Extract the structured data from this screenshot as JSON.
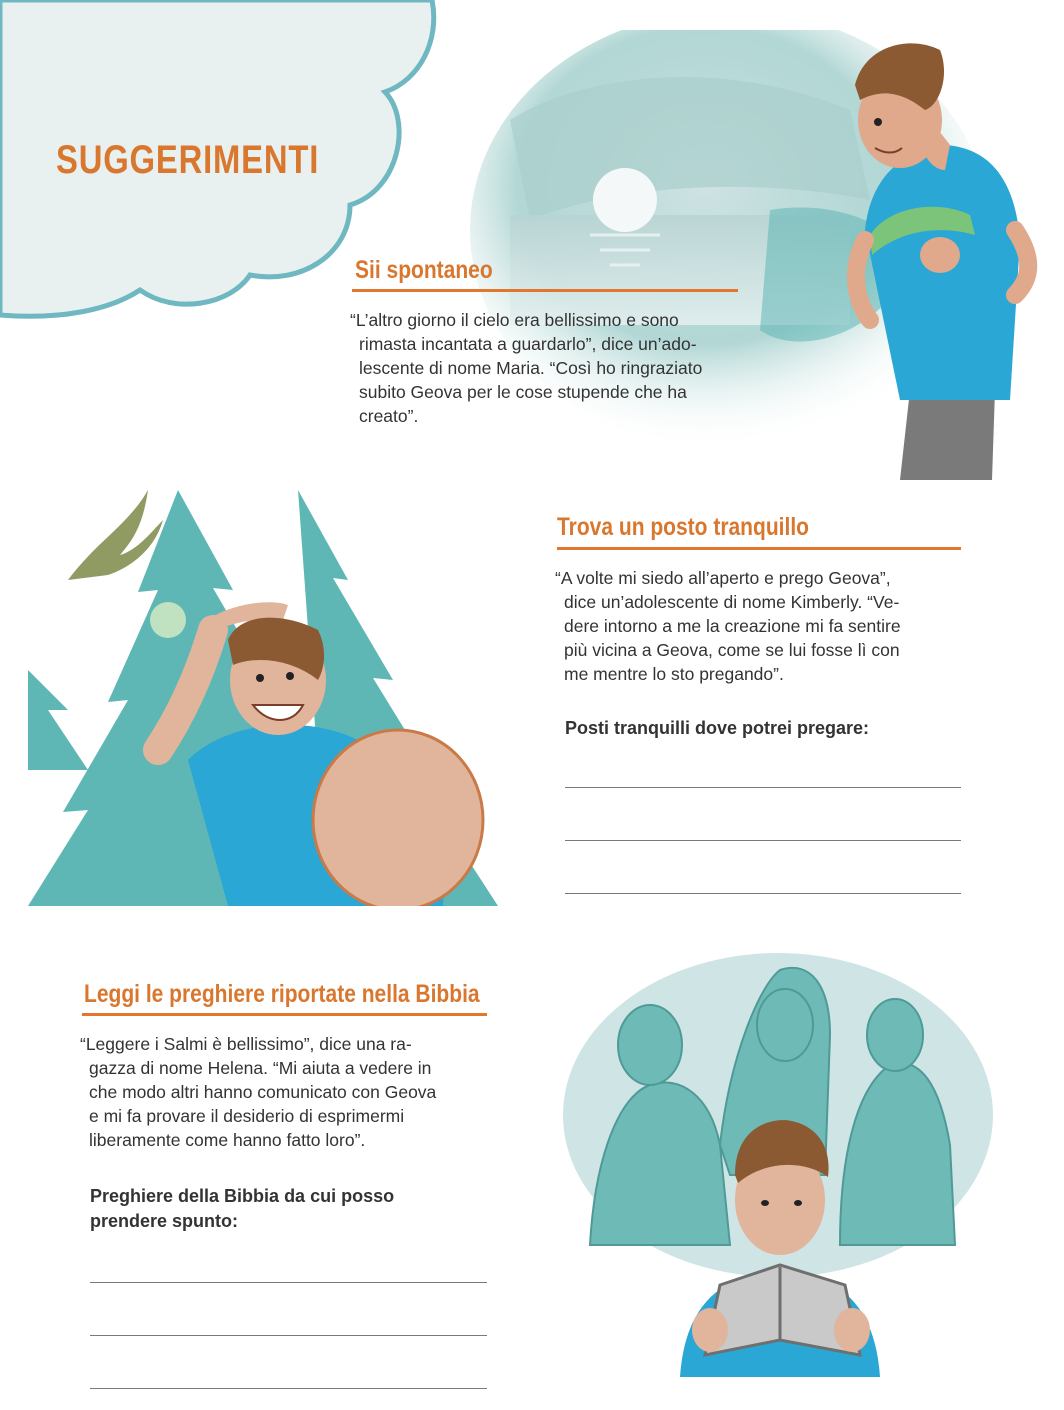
{
  "page": {
    "title": "SUGGERIMENTI"
  },
  "sections": [
    {
      "heading": "Sii spontaneo",
      "quote_lines": [
        "“L’altro giorno il cielo era bellissimo e sono",
        "rimasta incantata a guardarlo”, dice un’ado-",
        "lescente di nome Maria. “Così ho ringraziato",
        "subito Geova per le cose stupende che ha",
        "creato”."
      ]
    },
    {
      "heading": "Trova un posto tranquillo",
      "quote_lines": [
        "“A volte mi siedo all’aperto e prego Geova”,",
        "dice un’adolescente di nome Kimberly. “Ve-",
        "dere intorno a me la creazione mi fa sentire",
        "più vicina a Geova, come se lui fosse lì con",
        "me mentre lo sto pregando”."
      ],
      "prompt_lines": [
        "Posti tranquilli dove potrei pregare:"
      ],
      "write_lines": 3
    },
    {
      "heading": "Leggi le preghiere riportate nella Bibbia",
      "quote_lines": [
        "“Leggere i Salmi è bellissimo”, dice una ra-",
        "gazza di nome Helena. “Mi aiuta a vedere in",
        "che modo altri hanno comunicato con Geova",
        "e mi fa provare il desiderio di esprimermi",
        "liberamente come hanno fatto loro”."
      ],
      "prompt_lines": [
        "Preghiere della Bibbia da cui posso",
        "prendere spunto:"
      ],
      "write_lines": 3
    }
  ],
  "illustrations": {
    "top": "boy-walking-by-lake-sunset",
    "middle": "boy-looking-at-eagle-among-trees",
    "bottom": "boy-reading-bible-with-psalmists"
  },
  "colors": {
    "accent_orange": "#d9772e",
    "teal": "#5fb7b5",
    "cloud_fill": "#e9f0f0",
    "cloud_border": "#6fb8c2",
    "shirt_blue": "#2aa7d4"
  }
}
